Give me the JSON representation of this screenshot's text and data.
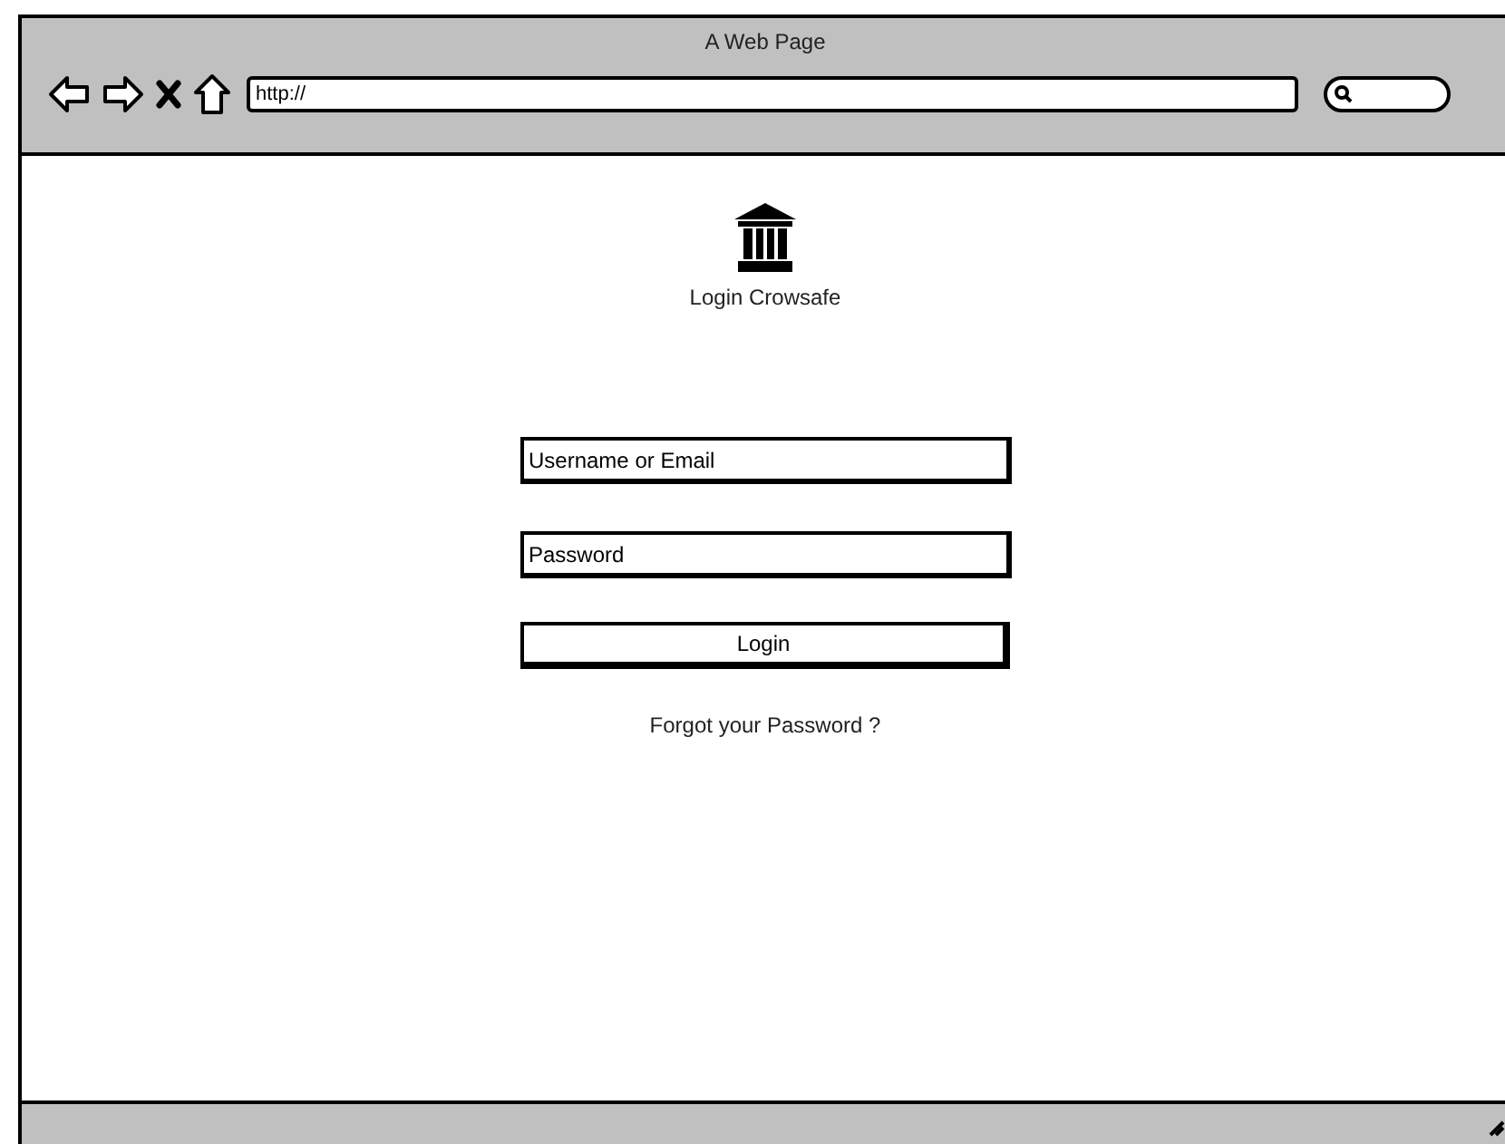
{
  "window": {
    "title": "A Web Page"
  },
  "address_bar": {
    "value": "http://"
  },
  "login": {
    "title": "Login Crowsafe",
    "fields": [
      {
        "placeholder": "Username or Email"
      },
      {
        "placeholder": "Password"
      }
    ],
    "button": "Login",
    "link": "Forgot your Password ?"
  }
}
